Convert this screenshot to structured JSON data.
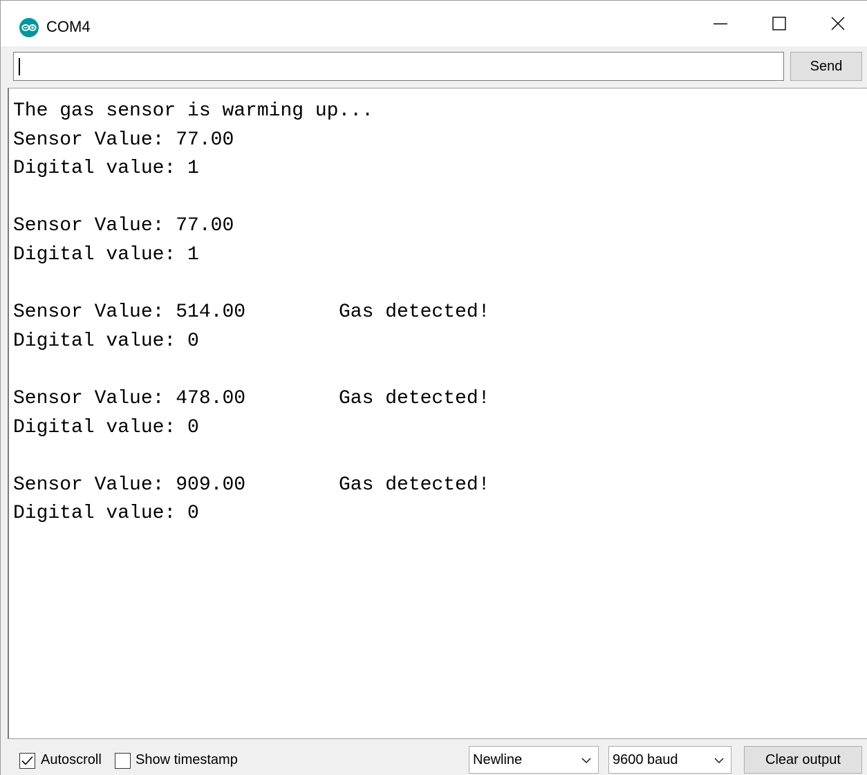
{
  "window": {
    "title": "COM4",
    "app_icon": "arduino-icon",
    "controls": [
      "minimize-icon",
      "maximize-icon",
      "close-icon"
    ]
  },
  "send": {
    "input_value": "",
    "button_label": "Send"
  },
  "output": {
    "lines": [
      {
        "text": "The gas sensor is warming up...",
        "note": ""
      },
      {
        "text": "Sensor Value: 77.00",
        "note": ""
      },
      {
        "text": "Digital value: 1",
        "note": ""
      },
      {
        "text": "",
        "note": ""
      },
      {
        "text": "Sensor Value: 77.00",
        "note": ""
      },
      {
        "text": "Digital value: 1",
        "note": ""
      },
      {
        "text": "",
        "note": ""
      },
      {
        "text": "Sensor Value: 514.00",
        "note": "Gas detected!"
      },
      {
        "text": "Digital value: 0",
        "note": ""
      },
      {
        "text": "",
        "note": ""
      },
      {
        "text": "Sensor Value: 478.00",
        "note": "Gas detected!"
      },
      {
        "text": "Digital value: 0",
        "note": ""
      },
      {
        "text": "",
        "note": ""
      },
      {
        "text": "Sensor Value: 909.00",
        "note": "Gas detected!"
      },
      {
        "text": "Digital value: 0",
        "note": ""
      }
    ]
  },
  "footer": {
    "autoscroll_label": "Autoscroll",
    "autoscroll_checked": true,
    "timestamp_label": "Show timestamp",
    "timestamp_checked": false,
    "line_ending": "Newline",
    "baud": "9600 baud",
    "clear_label": "Clear output"
  },
  "colors": {
    "arduino_teal": "#00979c",
    "chrome_bg": "#f0f0f0",
    "button_bg": "#e1e1e1"
  }
}
